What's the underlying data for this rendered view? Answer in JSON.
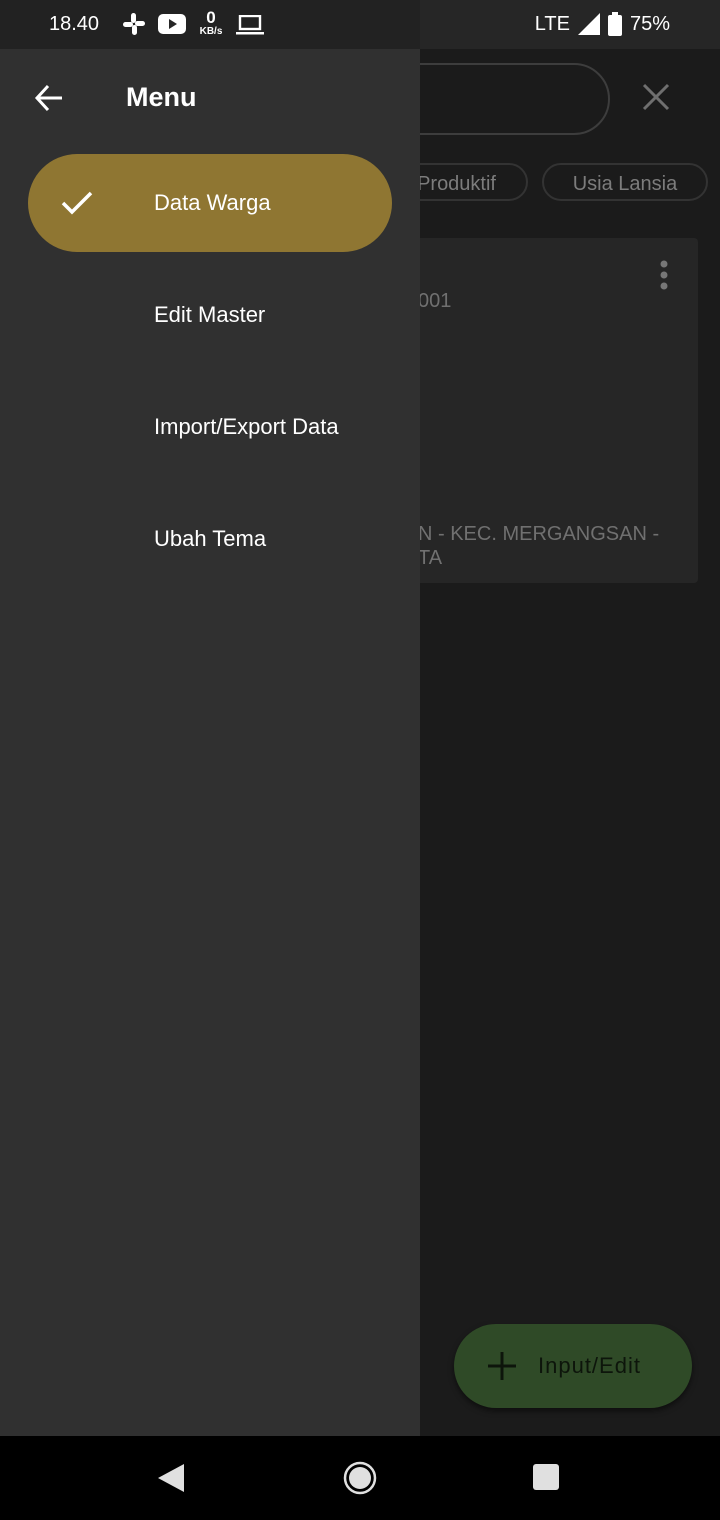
{
  "status_bar": {
    "time": "18.40",
    "net_speed_value": "0",
    "net_speed_unit": "KB/s",
    "network": "LTE",
    "battery": "75%"
  },
  "background": {
    "chips": [
      "Produktif",
      "Usia Lansia"
    ],
    "card_id_fragment": "001",
    "card_address_line1": "N - KEC. MERGANGSAN -",
    "card_address_line2": "TA",
    "fab_label": "Input/Edit"
  },
  "drawer": {
    "title": "Menu",
    "items": [
      {
        "label": "Data Warga",
        "active": true
      },
      {
        "label": "Edit Master",
        "active": false
      },
      {
        "label": "Import/Export Data",
        "active": false
      },
      {
        "label": "Ubah Tema",
        "active": false
      }
    ]
  },
  "colors": {
    "active_item": "#8f7632",
    "drawer_bg": "#303030",
    "fab_bg": "#2f4a27"
  }
}
